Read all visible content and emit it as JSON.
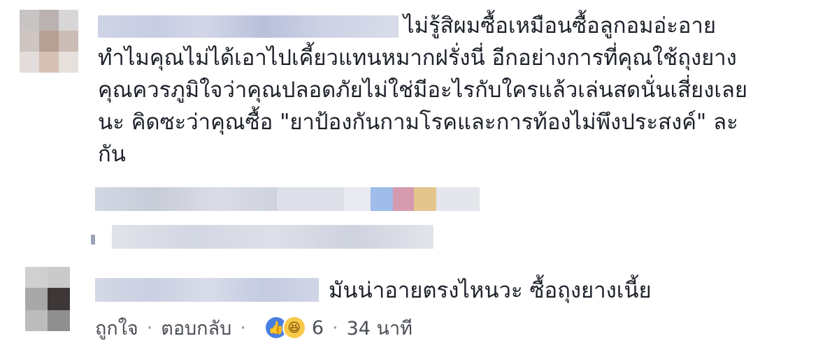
{
  "colors": {
    "text": "#1d2129",
    "meta": "#90949c",
    "like_blue": "#4a7fe2",
    "haha_yellow": "#f7c948"
  },
  "comment1": {
    "author": "",
    "lines": [
      "ไม่รู้สิผมซื้อเหมือนซื้อลูกอมอ่ะอาย",
      "ทำไมคุณไม่ได้เอาไปเคี้ยวแทนหมากฝรั่งนี่ อีกอย่างการที่คุณใช้ถุงยาง",
      "คุณควรภูมิใจว่าคุณปลอดภัยไม่ใช่มีอะไรกับใครแล้วเล่นสดนั่นเสี่ยงเลย",
      "นะ คิดซะว่าคุณซื้อ \"ยาป้องกันกามโรคและการท้องไม่พึงประสงค์\" ละ",
      "กัน"
    ],
    "avatar_icon": "blurred-avatar"
  },
  "comment2": {
    "author": "",
    "text": "มันน่าอายตรงไหนวะ ซื้อถุงยางเนี้ย",
    "avatar_icon": "blurred-avatar",
    "actions": {
      "like_label": "ถูกใจ",
      "reply_label": "ตอบกลับ",
      "separator": "·",
      "reaction_count": "6",
      "time": "34 นาที",
      "reaction_icons": [
        "like-reaction-icon",
        "haha-reaction-icon"
      ]
    }
  }
}
